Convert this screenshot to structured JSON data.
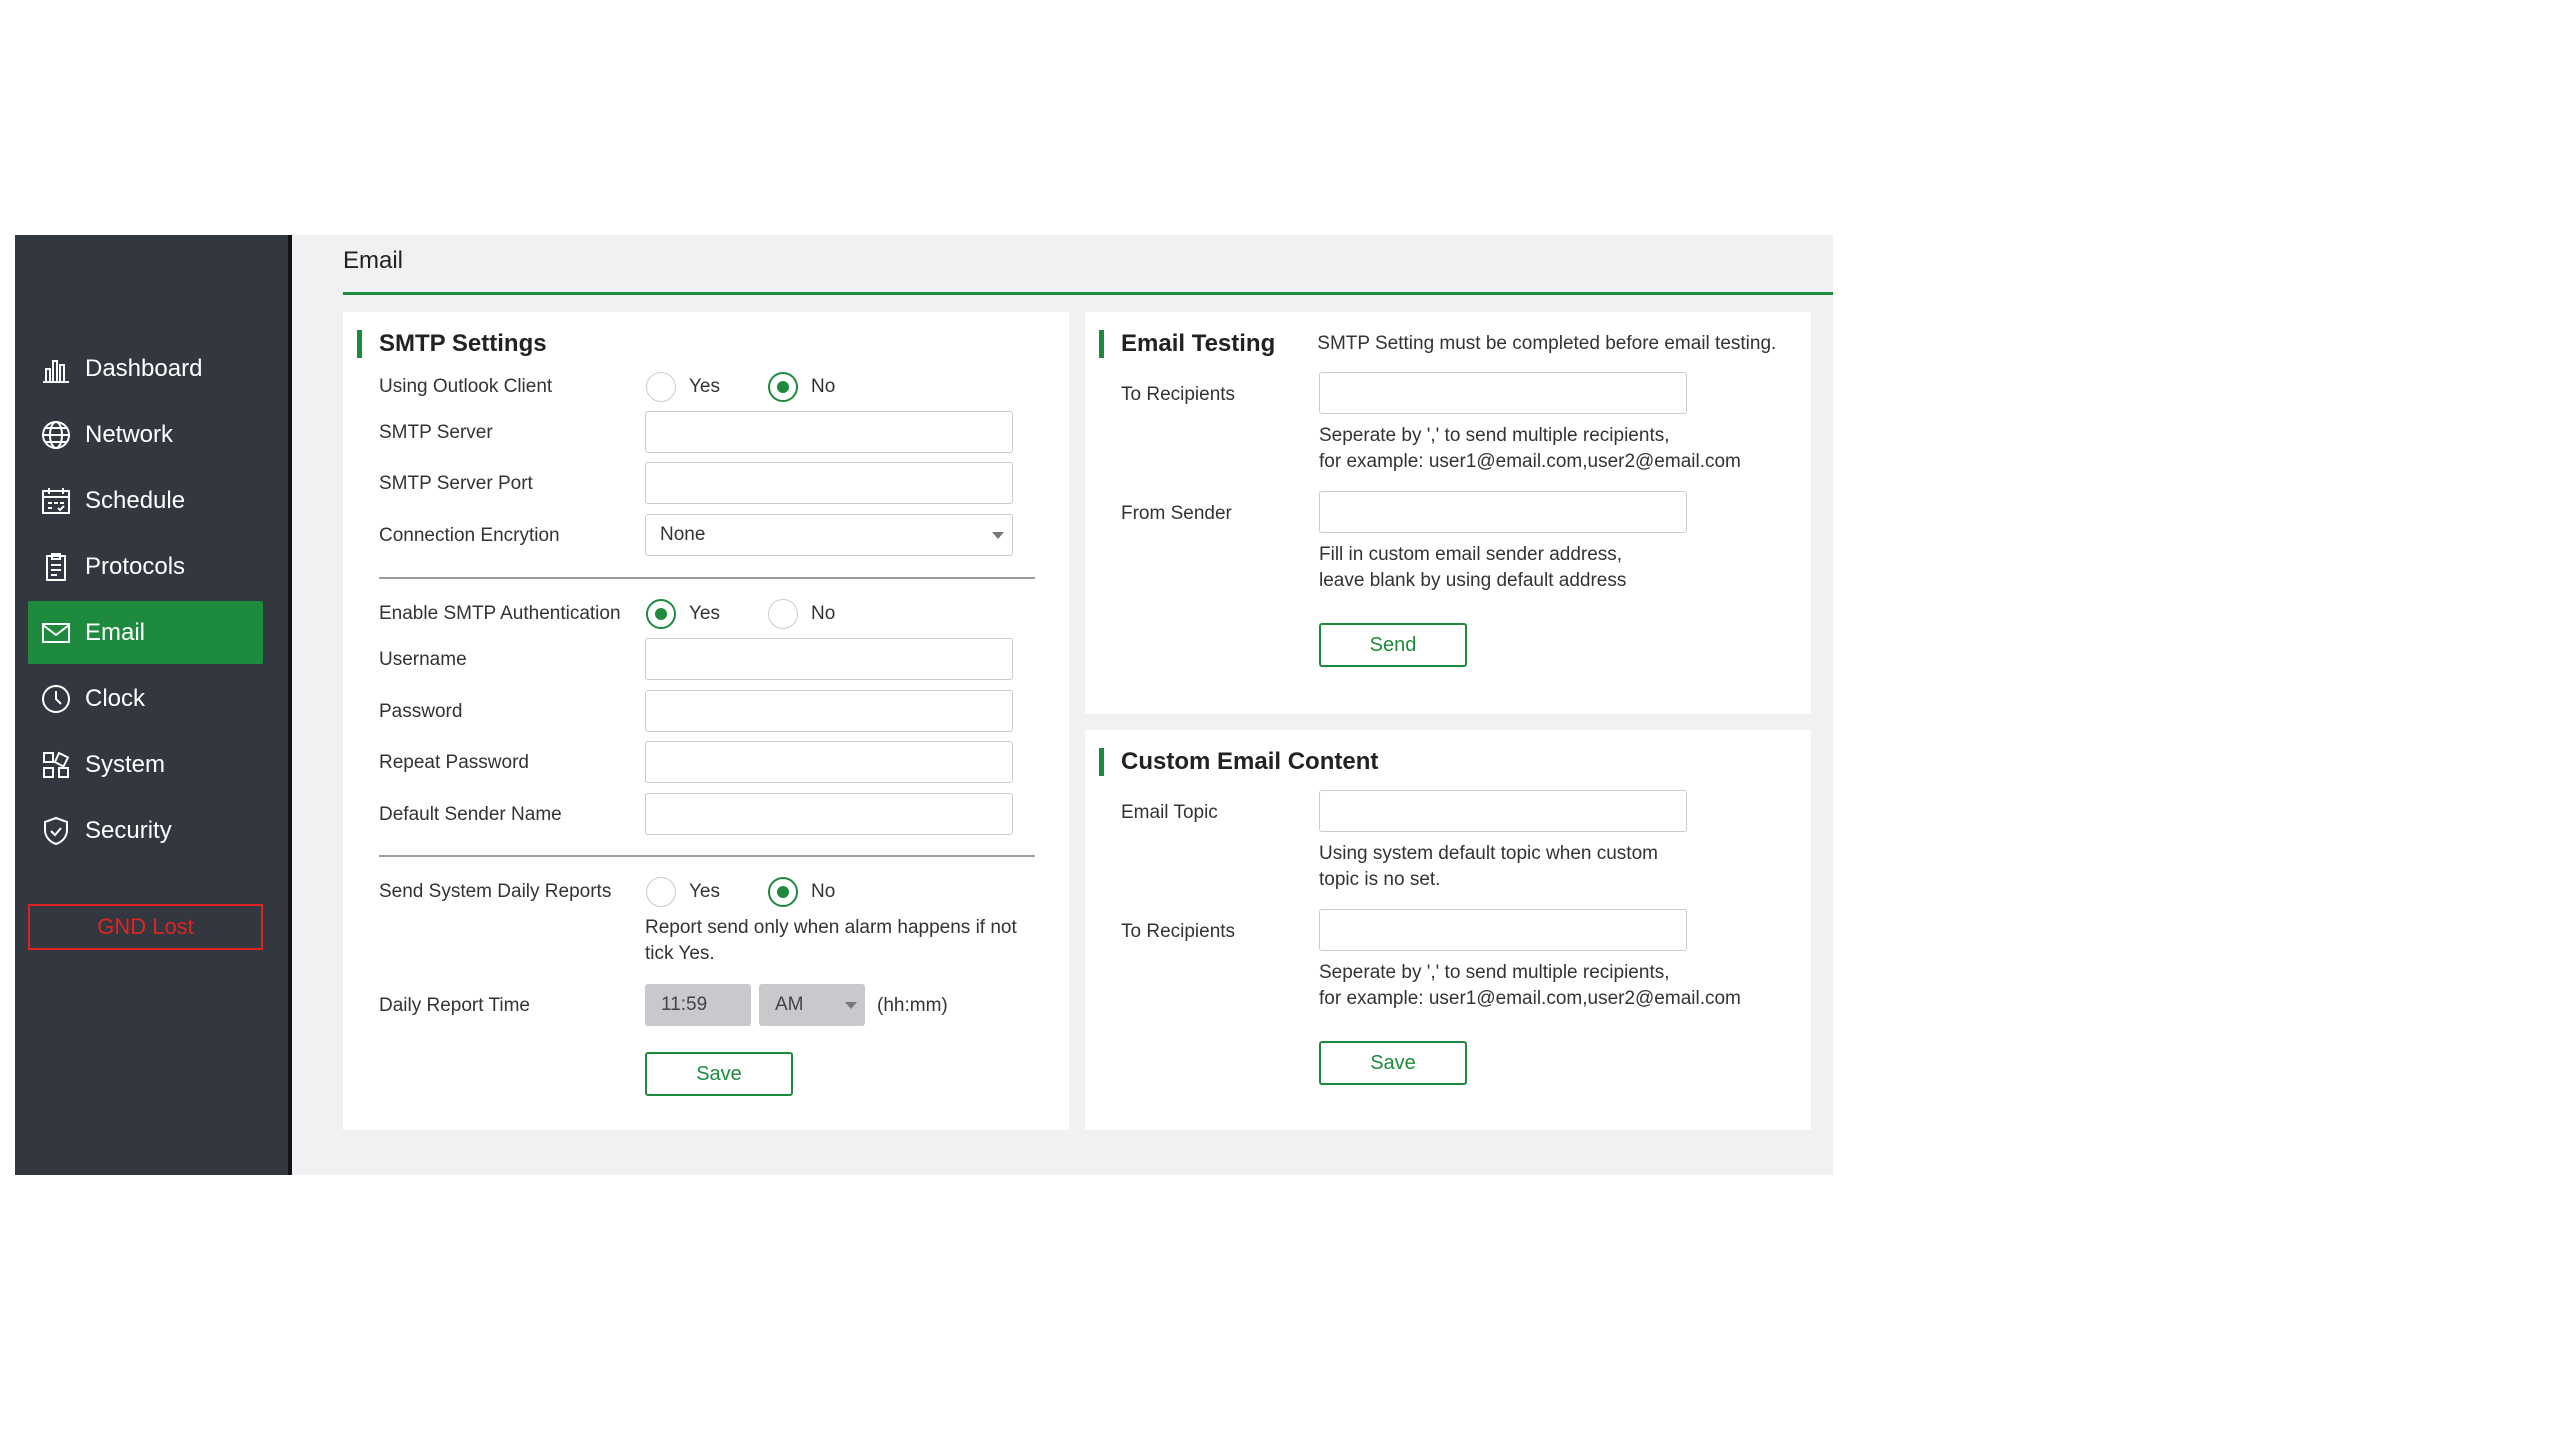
{
  "sidebar": {
    "items": [
      {
        "label": "Dashboard",
        "icon": "bar-chart-icon"
      },
      {
        "label": "Network",
        "icon": "globe-icon"
      },
      {
        "label": "Schedule",
        "icon": "calendar-icon"
      },
      {
        "label": "Protocols",
        "icon": "document-icon"
      },
      {
        "label": "Email",
        "icon": "envelope-icon",
        "active": true
      },
      {
        "label": "Clock",
        "icon": "clock-icon"
      },
      {
        "label": "System",
        "icon": "system-icon"
      },
      {
        "label": "Security",
        "icon": "shield-icon"
      }
    ],
    "status": "GND Lost"
  },
  "page": {
    "title": "Email"
  },
  "smtp": {
    "title": "SMTP Settings",
    "outlook_label": "Using Outlook Client",
    "outlook_yes": "Yes",
    "outlook_no": "No",
    "server_label": "SMTP Server",
    "server_value": "",
    "port_label": "SMTP Server Port",
    "port_value": "",
    "encryption_label": "Connection Encrytion",
    "encryption_value": "None",
    "auth_label": "Enable SMTP Authentication",
    "auth_yes": "Yes",
    "auth_no": "No",
    "username_label": "Username",
    "password_label": "Password",
    "repeat_password_label": "Repeat Password",
    "sender_name_label": "Default Sender Name",
    "daily_label": "Send System Daily Reports",
    "daily_yes": "Yes",
    "daily_no": "No",
    "daily_help": "Report send only when alarm happens if not tick Yes.",
    "time_label": "Daily Report Time",
    "time_value": "11:59",
    "ampm_value": "AM",
    "time_format": "(hh:mm)",
    "save": "Save"
  },
  "testing": {
    "title": "Email Testing",
    "note": "SMTP Setting must be completed before email testing.",
    "to_label": "To Recipients",
    "to_help_1": "Seperate by ',' to send multiple recipients,",
    "to_help_2": "for example: user1@email.com,user2@email.com",
    "from_label": "From Sender",
    "from_help_1": "Fill in custom email sender address,",
    "from_help_2": "leave blank by using default address",
    "send": "Send"
  },
  "custom": {
    "title": "Custom Email Content",
    "topic_label": "Email Topic",
    "topic_help_1": "Using system default topic when custom",
    "topic_help_2": "topic is no set.",
    "to_label": "To Recipients",
    "to_help_1": "Seperate by ',' to send multiple recipients,",
    "to_help_2": "for example: user1@email.com,user2@email.com",
    "save": "Save"
  },
  "colors": {
    "accent": "#1e8a3e",
    "sidebar": "#333840",
    "alert": "#e02424"
  }
}
